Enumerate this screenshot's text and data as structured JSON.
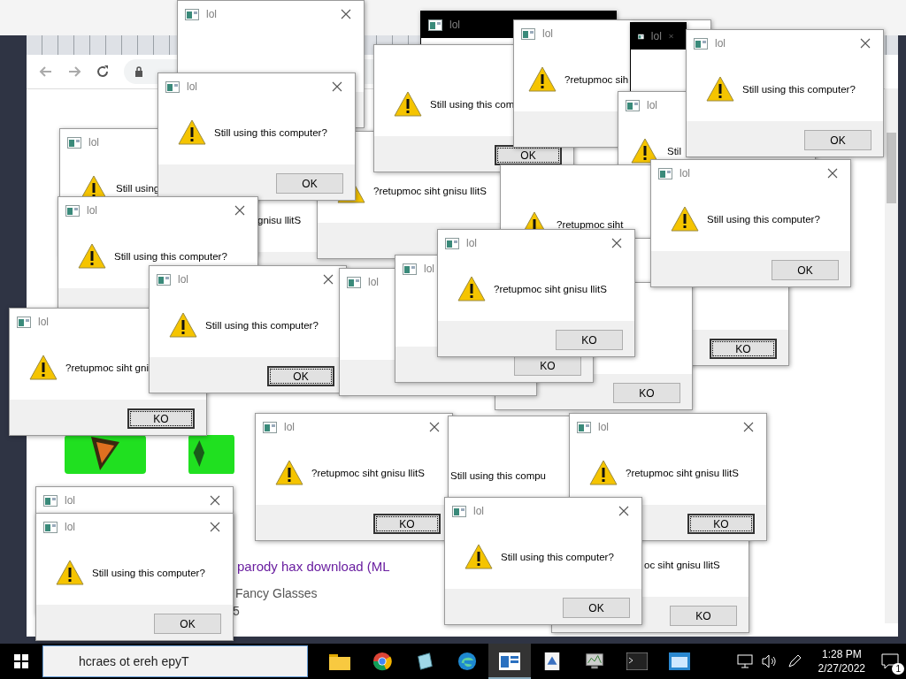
{
  "browser": {
    "results": [
      {
        "kind": "link",
        "text": "parody hax download (ML"
      },
      {
        "kind": "snippet",
        "text": "Fancy Glasses"
      },
      {
        "kind": "snippet",
        "text": "5"
      }
    ]
  },
  "dialogs": [
    {
      "kind": "normal",
      "title": "lol"
    },
    {
      "kind": "dark",
      "title": "lol"
    },
    {
      "kind": "normal",
      "message": "gnisu llitS"
    },
    {
      "kind": "normal",
      "message": "?retupmoc siht gnisu llitS"
    },
    {
      "kind": "normal",
      "message": "Still using this com",
      "button": {
        "label": "OK",
        "focused": true
      }
    },
    {
      "kind": "normal",
      "title": "lol",
      "message": "?retupmoc sih"
    },
    {
      "kind": "dark",
      "title": "lol"
    },
    {
      "kind": "normal",
      "title": "lol",
      "message": "Stil"
    },
    {
      "kind": "normal",
      "message": "?retupmoc siht"
    },
    {
      "kind": "normal",
      "button": {
        "label": "KO",
        "focused": true
      }
    },
    {
      "kind": "normal",
      "button": {
        "label": "KO",
        "focused": false
      }
    },
    {
      "kind": "normal",
      "title": "lol",
      "message": "Still using this computer?",
      "button": {
        "label": "OK",
        "focused": false
      }
    },
    {
      "kind": "normal",
      "title": "lol",
      "message": "Still using this computer?",
      "button": {
        "label": "OK",
        "focused": false
      }
    },
    {
      "kind": "normal",
      "title": "lol",
      "message": "Still using"
    },
    {
      "kind": "normal",
      "title": "lol",
      "message": "Still using this computer?",
      "button": {
        "label": "OK",
        "focused": false
      }
    },
    {
      "kind": "normal",
      "title": "lol",
      "message": "Still using this computer?"
    },
    {
      "kind": "normal",
      "title": "lol",
      "message": "?retupmoc siht gni",
      "button": {
        "label": "KO",
        "focused": true
      }
    },
    {
      "kind": "normal",
      "title": "lol",
      "message": "Still using this computer?",
      "button": {
        "label": "OK",
        "focused": true
      }
    },
    {
      "kind": "normal",
      "title": "lol"
    },
    {
      "kind": "normal",
      "title": "lol",
      "button": {
        "label": "KO",
        "focused": false
      }
    },
    {
      "kind": "normal",
      "title": "lol",
      "message": "?retupmoc siht gnisu llitS",
      "button": {
        "label": "KO",
        "focused": false
      }
    },
    {
      "kind": "normal",
      "title": "lol",
      "message": "?retupmoc siht gnisu llitS",
      "button": {
        "label": "KO",
        "focused": true
      }
    },
    {
      "kind": "normal",
      "message": "Still using this compu"
    },
    {
      "kind": "normal",
      "title": "lol",
      "message": "?retupmoc siht gnisu llitS",
      "button": {
        "label": "KO",
        "focused": true
      }
    },
    {
      "kind": "normal",
      "message": "oc siht gnisu llitS",
      "button": {
        "label": "KO",
        "focused": false
      }
    },
    {
      "kind": "normal",
      "title": "lol"
    },
    {
      "kind": "normal",
      "title": "lol",
      "message": "Still using this computer?",
      "button": {
        "label": "OK",
        "focused": false
      }
    },
    {
      "kind": "normal",
      "title": "lol",
      "message": "Still using this computer?",
      "button": {
        "label": "OK",
        "focused": false
      }
    }
  ],
  "taskbar": {
    "search": {
      "placeholder": "hcraes ot ereh epyT"
    },
    "apps": [
      {
        "kind": "folder",
        "selected": false
      },
      {
        "kind": "chrome",
        "selected": false
      },
      {
        "kind": "notepad",
        "selected": false
      },
      {
        "kind": "edge",
        "selected": false
      },
      {
        "kind": "app",
        "selected": true
      },
      {
        "kind": "paint",
        "selected": false
      },
      {
        "kind": "monitor",
        "selected": false
      },
      {
        "kind": "terminal",
        "selected": false
      },
      {
        "kind": "window",
        "selected": false
      }
    ],
    "clock": {
      "time": "1:28 PM",
      "date": "2/27/2022"
    },
    "notifications": {
      "count": "1"
    }
  }
}
